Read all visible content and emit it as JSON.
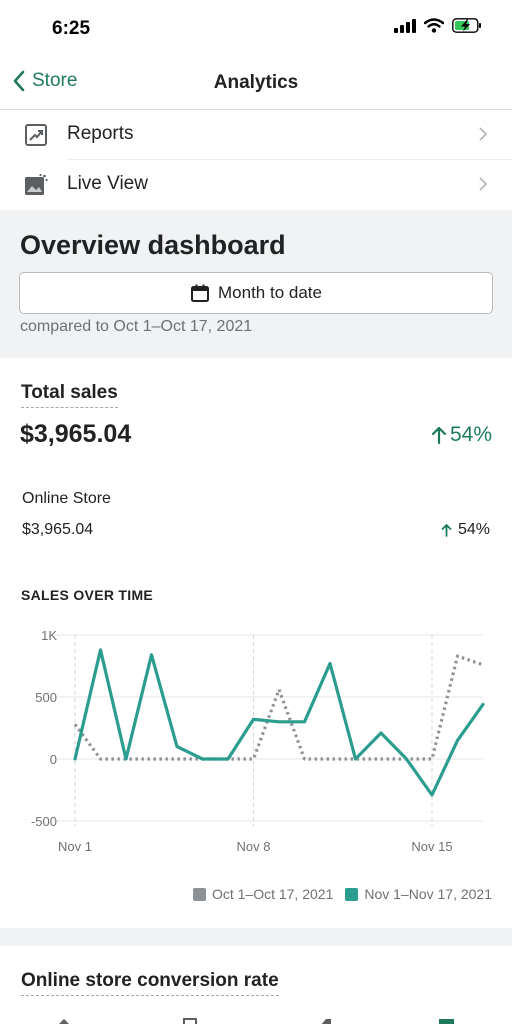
{
  "status": {
    "time": "6:25"
  },
  "nav": {
    "back_label": "Store",
    "title": "Analytics"
  },
  "menu": [
    {
      "label": "Reports",
      "icon": "reports-icon"
    },
    {
      "label": "Live View",
      "icon": "live-view-icon"
    }
  ],
  "overview": {
    "title": "Overview dashboard",
    "date_button": "Month to date",
    "compare_text": "compared to Oct 1–Oct 17, 2021"
  },
  "total_sales": {
    "label": "Total sales",
    "value": "$3,965.04",
    "change": "54%",
    "channel_label": "Online Store",
    "channel_value": "$3,965.04",
    "channel_change": "54%"
  },
  "chart_heading": "SALES OVER TIME",
  "chart_data": {
    "type": "line",
    "x": [
      "Nov 1",
      "Nov 2",
      "Nov 3",
      "Nov 4",
      "Nov 5",
      "Nov 6",
      "Nov 7",
      "Nov 8",
      "Nov 9",
      "Nov 10",
      "Nov 11",
      "Nov 12",
      "Nov 13",
      "Nov 14",
      "Nov 15",
      "Nov 16",
      "Nov 17"
    ],
    "x_tick_labels": [
      "Nov 1",
      "Nov 8",
      "Nov 15"
    ],
    "y_tick_labels": [
      "1K",
      "500",
      "0",
      "-500"
    ],
    "ylim": [
      -500,
      1000
    ],
    "grid": true,
    "legend_position": "bottom-right",
    "series": [
      {
        "name": "Oct 1–Oct 17, 2021",
        "style": "dotted",
        "color": "#8c9196",
        "values": [
          280,
          0,
          0,
          0,
          0,
          0,
          0,
          0,
          560,
          0,
          0,
          0,
          0,
          0,
          0,
          830,
          760
        ]
      },
      {
        "name": "Nov 1–Nov 17, 2021",
        "style": "solid",
        "color": "#2a9d8f",
        "values": [
          0,
          880,
          0,
          840,
          100,
          0,
          0,
          320,
          300,
          300,
          770,
          0,
          210,
          0,
          -290,
          150,
          440
        ]
      }
    ]
  },
  "conversion": {
    "title": "Online store conversion rate"
  },
  "colors": {
    "accent": "#1f7a5a",
    "teal": "#2a9d8f",
    "gray": "#8c9196"
  }
}
